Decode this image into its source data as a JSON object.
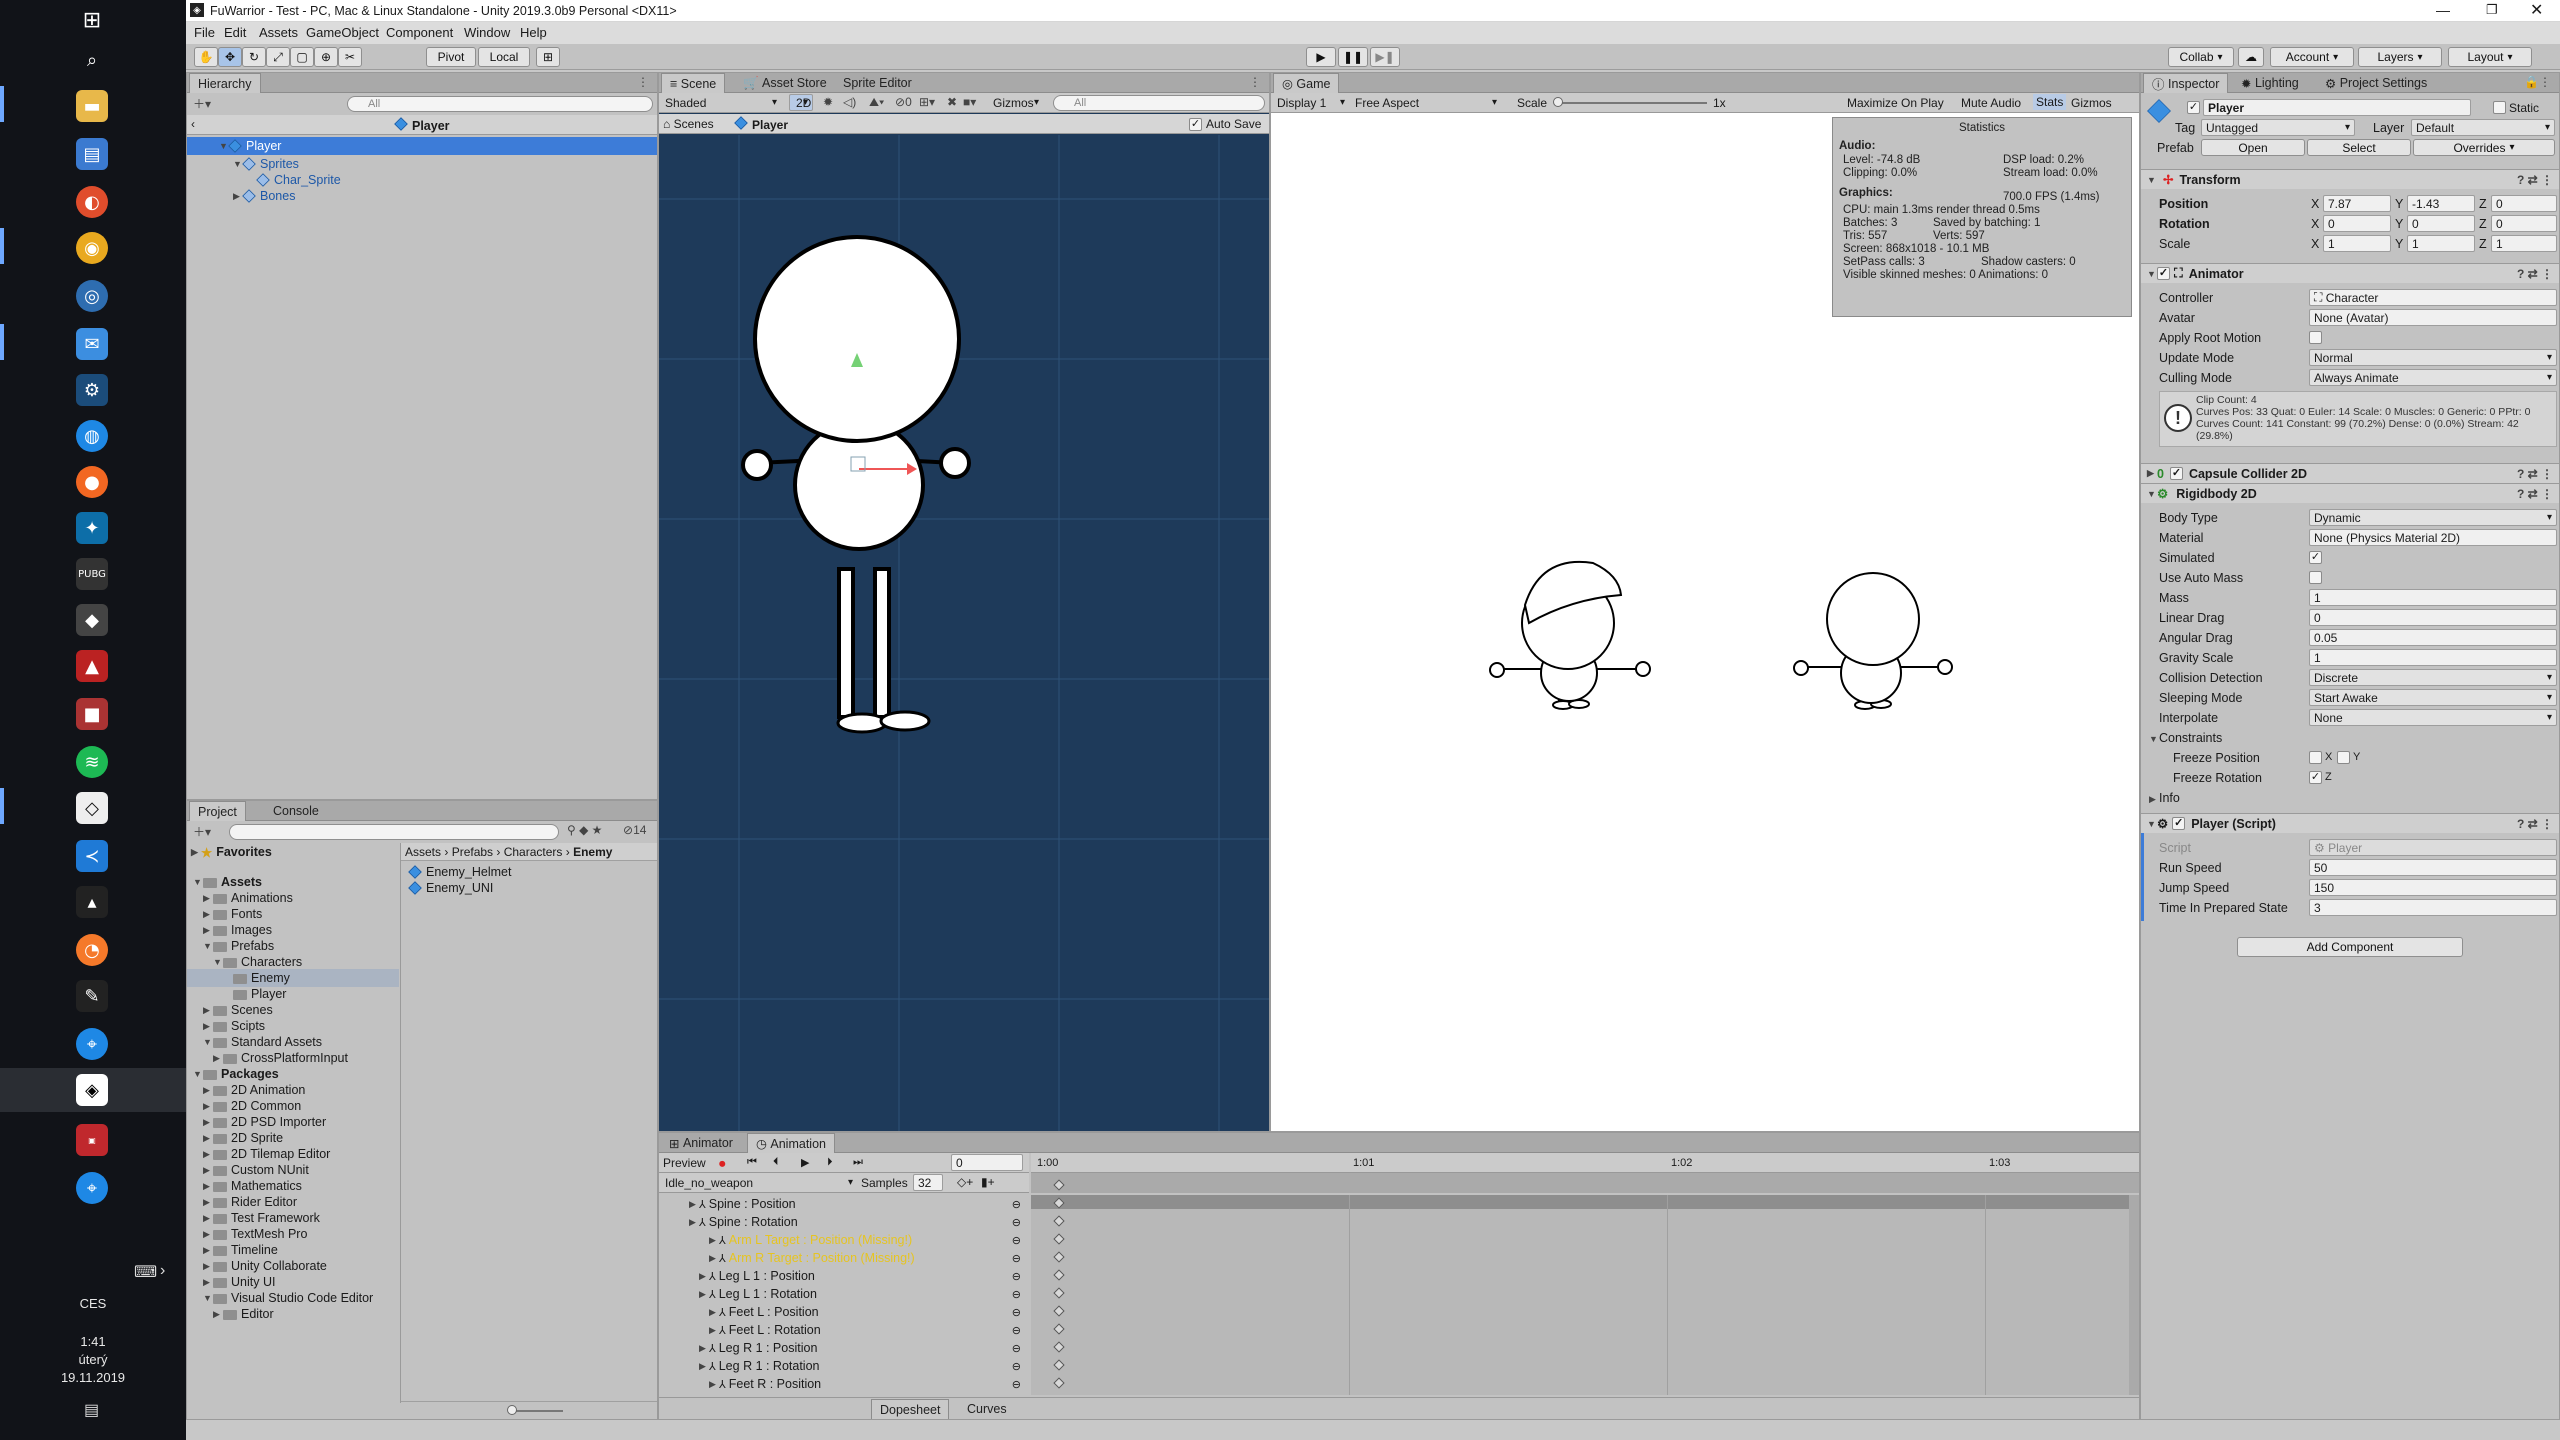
{
  "taskbar": {
    "icons": [
      "windows-start-icon",
      "search-icon",
      "file-explorer-icon",
      "notepad-icon",
      "chromium-icon",
      "chrome-icon",
      "screenshot-tool-icon",
      "outlook-icon",
      "steam-icon",
      "uplay-icon",
      "origin-icon",
      "battlenet-icon",
      "pubg-icon",
      "epic-icon",
      "app-icon",
      "app2-icon",
      "spotify-icon",
      "unity-hub-icon",
      "vscode-icon",
      "dark-app-icon",
      "blender-icon",
      "tool-icon",
      "maps-icon",
      "unity-icon",
      "vsoft-icon",
      "maps2-icon"
    ],
    "lang": "CES",
    "time": "1:41",
    "day": "úterý",
    "date": "19.11.2019"
  },
  "window": {
    "title": "FuWarrior - Test - PC, Mac & Linux Standalone - Unity 2019.3.0b9 Personal <DX11>"
  },
  "menu": [
    "File",
    "Edit",
    "Assets",
    "GameObject",
    "Component",
    "Window",
    "Help"
  ],
  "toolbar": {
    "pivot": "Pivot",
    "local": "Local",
    "collab": "Collab",
    "account": "Account",
    "layers": "Layers",
    "layout": "Layout"
  },
  "hierarchy": {
    "tab": "Hierarchy",
    "search_placeholder": "All",
    "scene_title": "Player",
    "items": [
      {
        "label": "Player",
        "depth": 0,
        "selected": true
      },
      {
        "label": "Sprites",
        "depth": 1
      },
      {
        "label": "Char_Sprite",
        "depth": 2
      },
      {
        "label": "Bones",
        "depth": 1
      }
    ]
  },
  "project": {
    "tabs": [
      "Project",
      "Console"
    ],
    "count": "14",
    "favorites": "Favorites",
    "tree": [
      {
        "label": "Assets",
        "depth": 0,
        "bold": true
      },
      {
        "label": "Animations",
        "depth": 1
      },
      {
        "label": "Fonts",
        "depth": 1
      },
      {
        "label": "Images",
        "depth": 1
      },
      {
        "label": "Prefabs",
        "depth": 1
      },
      {
        "label": "Characters",
        "depth": 2
      },
      {
        "label": "Enemy",
        "depth": 3,
        "selected": true
      },
      {
        "label": "Player",
        "depth": 3
      },
      {
        "label": "Scenes",
        "depth": 1
      },
      {
        "label": "Scipts",
        "depth": 1
      },
      {
        "label": "Standard Assets",
        "depth": 1
      },
      {
        "label": "CrossPlatformInput",
        "depth": 2
      },
      {
        "label": "Packages",
        "depth": 0,
        "bold": true
      },
      {
        "label": "2D Animation",
        "depth": 1
      },
      {
        "label": "2D Common",
        "depth": 1
      },
      {
        "label": "2D PSD Importer",
        "depth": 1
      },
      {
        "label": "2D Sprite",
        "depth": 1
      },
      {
        "label": "2D Tilemap Editor",
        "depth": 1
      },
      {
        "label": "Custom NUnit",
        "depth": 1
      },
      {
        "label": "Mathematics",
        "depth": 1
      },
      {
        "label": "Rider Editor",
        "depth": 1
      },
      {
        "label": "Test Framework",
        "depth": 1
      },
      {
        "label": "TextMesh Pro",
        "depth": 1
      },
      {
        "label": "Timeline",
        "depth": 1
      },
      {
        "label": "Unity Collaborate",
        "depth": 1
      },
      {
        "label": "Unity UI",
        "depth": 1
      },
      {
        "label": "Visual Studio Code Editor",
        "depth": 1
      },
      {
        "label": "Editor",
        "depth": 2
      }
    ],
    "breadcrumb": [
      "Assets",
      "Prefabs",
      "Characters",
      "Enemy"
    ],
    "files": [
      "Enemy_Helmet",
      "Enemy_UNI"
    ]
  },
  "scene": {
    "tabs": [
      "Scene",
      "Asset Store",
      "Sprite Editor"
    ],
    "shading": "Shaded",
    "mode2d": "2D",
    "lights": "0",
    "gizmos": "Gizmos",
    "search_placeholder": "All",
    "breadcrumb_scenes": "Scenes",
    "breadcrumb_player": "Player",
    "autosave": "Auto Save"
  },
  "game": {
    "tab": "Game",
    "display": "Display 1",
    "aspect": "Free Aspect",
    "scale_label": "Scale",
    "scale_value": "1x",
    "maximize": "Maximize On Play",
    "mute": "Mute Audio",
    "stats": "Stats",
    "gizmos": "Gizmos",
    "statistics": {
      "title": "Statistics",
      "audio": "Audio:",
      "level": "Level: -74.8 dB",
      "dsp": "DSP load: 0.2%",
      "clipping": "Clipping: 0.0%",
      "stream": "Stream load: 0.0%",
      "graphics": "Graphics:",
      "fps": "700.0 FPS (1.4ms)",
      "cpu": "CPU: main 1.3ms  render thread 0.5ms",
      "batches": "Batches: 3",
      "saved": "Saved by batching: 1",
      "tris": "Tris: 557",
      "verts": "Verts: 597",
      "screen": "Screen: 868x1018 - 10.1 MB",
      "setpass": "SetPass calls: 3",
      "shadow": "Shadow casters: 0",
      "skinned": "Visible skinned meshes: 0  Animations: 0"
    }
  },
  "animation": {
    "tabs": [
      "Animator",
      "Animation"
    ],
    "preview": "Preview",
    "frame": "0",
    "clip": "Idle_no_weapon",
    "samples_label": "Samples",
    "samples": "32",
    "ruler": [
      "1:00",
      "1:01",
      "1:02",
      "1:03"
    ],
    "tracks": [
      {
        "label": "Spine : Position",
        "indent": 1,
        "missing": false
      },
      {
        "label": "Spine : Rotation",
        "indent": 1,
        "missing": false
      },
      {
        "label": "Arm L Target : Position (Missing!)",
        "indent": 3,
        "missing": true
      },
      {
        "label": "Arm R Target : Position (Missing!)",
        "indent": 3,
        "missing": true
      },
      {
        "label": "Leg L 1 : Position",
        "indent": 2,
        "missing": false
      },
      {
        "label": "Leg L 1 : Rotation",
        "indent": 2,
        "missing": false
      },
      {
        "label": "Feet L : Position",
        "indent": 3,
        "missing": false
      },
      {
        "label": "Feet L : Rotation",
        "indent": 3,
        "missing": false
      },
      {
        "label": "Leg R 1 : Position",
        "indent": 2,
        "missing": false
      },
      {
        "label": "Leg R 1 : Rotation",
        "indent": 2,
        "missing": false
      },
      {
        "label": "Feet R : Position",
        "indent": 3,
        "missing": false
      }
    ],
    "dopesheet": "Dopesheet",
    "curves": "Curves"
  },
  "inspector": {
    "tabs": [
      "Inspector",
      "Lighting",
      "Project Settings"
    ],
    "object_name": "Player",
    "static_label": "Static",
    "tag_label": "Tag",
    "tag_value": "Untagged",
    "layer_label": "Layer",
    "layer_value": "Default",
    "prefab_label": "Prefab",
    "prefab_open": "Open",
    "prefab_select": "Select",
    "prefab_overrides": "Overrides",
    "transform": {
      "title": "Transform",
      "position_label": "Position",
      "px": "7.87",
      "py": "-1.43",
      "pz": "0",
      "rotation_label": "Rotation",
      "rx": "0",
      "ry": "0",
      "rz": "0",
      "scale_label": "Scale",
      "sx": "1",
      "sy": "1",
      "sz": "1"
    },
    "animator": {
      "title": "Animator",
      "controller_label": "Controller",
      "controller": "Character",
      "avatar_label": "Avatar",
      "avatar": "None (Avatar)",
      "root_motion_label": "Apply Root Motion",
      "update_label": "Update Mode",
      "update": "Normal",
      "culling_label": "Culling Mode",
      "culling": "Always Animate",
      "info1": "Clip Count: 4",
      "info2": "Curves Pos: 33 Quat: 0 Euler: 14 Scale: 0 Muscles: 0 Generic: 0 PPtr: 0",
      "info3": "Curves Count: 141 Constant: 99 (70.2%) Dense: 0 (0.0%) Stream: 42",
      "info4": "(29.8%)"
    },
    "capsule": {
      "title": "Capsule Collider 2D"
    },
    "rigidbody": {
      "title": "Rigidbody 2D",
      "body_type_label": "Body Type",
      "body_type": "Dynamic",
      "material_label": "Material",
      "material": "None (Physics Material 2D)",
      "simulated_label": "Simulated",
      "auto_mass_label": "Use Auto Mass",
      "mass_label": "Mass",
      "mass": "1",
      "linear_drag_label": "Linear Drag",
      "linear_drag": "0",
      "angular_drag_label": "Angular Drag",
      "angular_drag": "0.05",
      "gravity_label": "Gravity Scale",
      "gravity": "1",
      "collision_label": "Collision Detection",
      "collision": "Discrete",
      "sleeping_label": "Sleeping Mode",
      "sleeping": "Start Awake",
      "interpolate_label": "Interpolate",
      "interpolate": "None",
      "constraints_label": "Constraints",
      "freeze_pos_label": "Freeze Position",
      "x": "X",
      "y": "Y",
      "freeze_rot_label": "Freeze Rotation",
      "z": "Z",
      "info_label": "Info"
    },
    "script": {
      "title": "Player (Script)",
      "script_label": "Script",
      "script_value": "Player",
      "run_label": "Run Speed",
      "run": "50",
      "jump_label": "Jump Speed",
      "jump": "150",
      "time_label": "Time In Prepared State",
      "time": "3"
    },
    "add_component": "Add Component"
  },
  "colors": {
    "scene_bg": "#1e3a5a",
    "selection": "#3d7cd8",
    "missing": "#e6c422",
    "link": "#1d58a8"
  }
}
